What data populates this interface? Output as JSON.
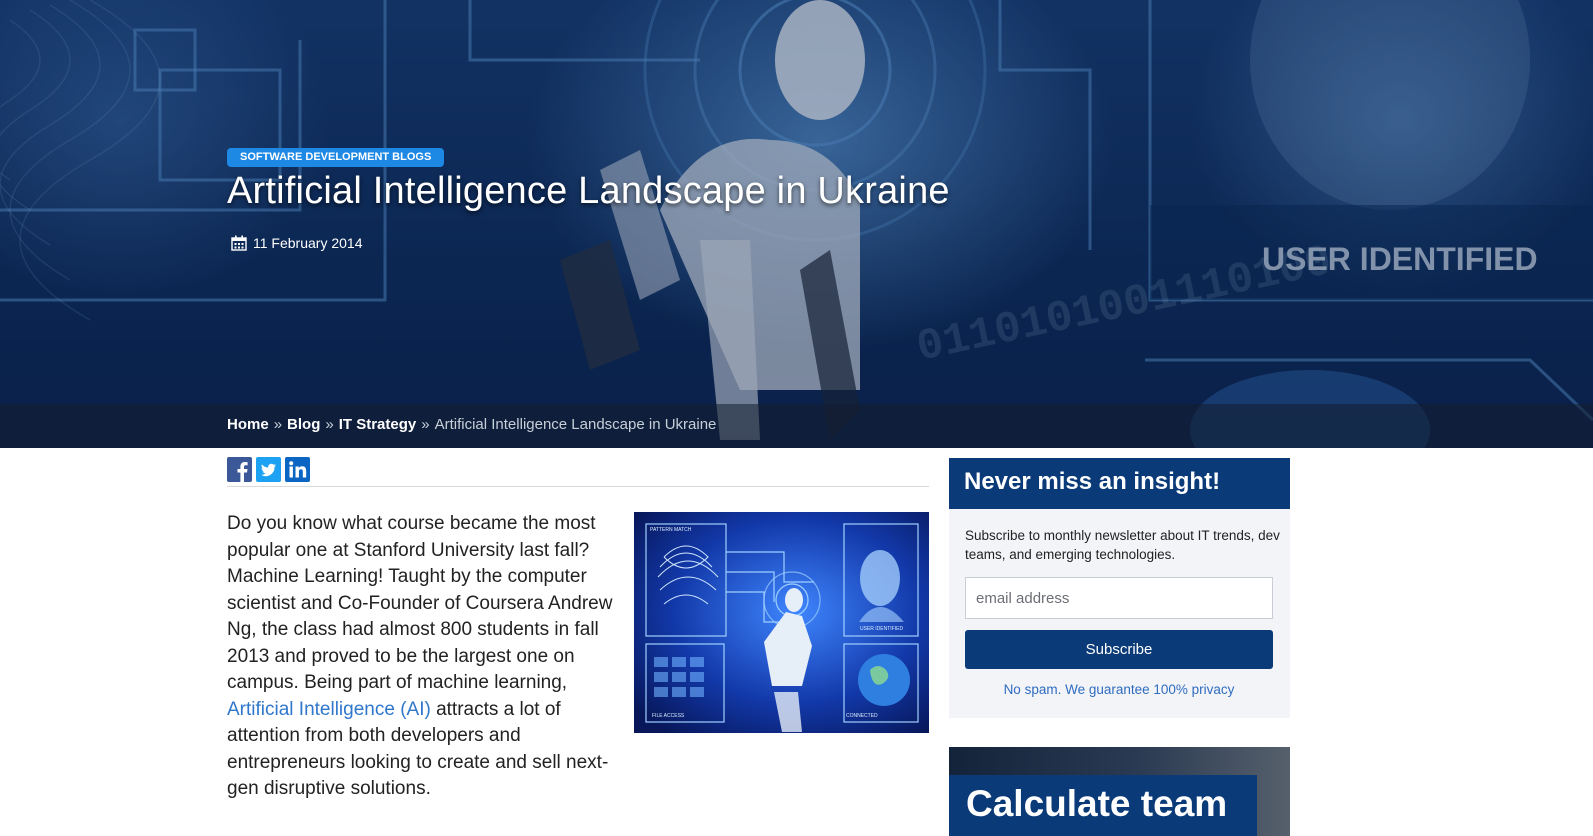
{
  "hero": {
    "category_badge": "SOFTWARE DEVELOPMENT BLOGS",
    "title": "Artificial Intelligence Landscape in Ukraine",
    "date": "11 February 2014",
    "background_overlay_text": "USER IDENTIFIED",
    "binary_text": "0110101001110100"
  },
  "breadcrumb": {
    "items": [
      "Home",
      "Blog",
      "IT Strategy"
    ],
    "separator": "»",
    "current": "Artificial Intelligence Landscape in Ukraine"
  },
  "share": {
    "icons": [
      "facebook-icon",
      "twitter-icon",
      "linkedin-icon"
    ]
  },
  "article": {
    "p1_before_link": "Do you know what course became the most popular one at Stanford University last fall? Machine Learning! Taught by the computer scientist and Co-Founder of Coursera Andrew Ng, the class had almost 800 students in fall 2013 and proved to be the largest one on campus. Being part of machine learning, ",
    "p1_link": "Artificial Intelligence (AI)",
    "p1_after_link": " attracts a lot of attention from both developers and entrepreneurs looking to create and sell next-gen disruptive solutions.",
    "image_labels": {
      "pattern_match": "PATTERN MATCH",
      "user_identified": "USER IDENTIFIED",
      "file_access": "FILE ACCESS",
      "connected": "CONNECTED"
    }
  },
  "sidebar": {
    "newsletter": {
      "title": "Never miss an insight!",
      "description": "Subscribe to monthly newsletter about IT trends, dev teams, and emerging technologies.",
      "email_placeholder": "email address",
      "subscribe_label": "Subscribe",
      "note": "No spam. We guarantee 100% privacy"
    },
    "calculator": {
      "title": "Calculate team"
    }
  },
  "colors": {
    "badge": "#1e88e5",
    "navy": "#0a3a78",
    "link": "#2f77cc",
    "sidebar_bg": "#f2f4f7"
  }
}
